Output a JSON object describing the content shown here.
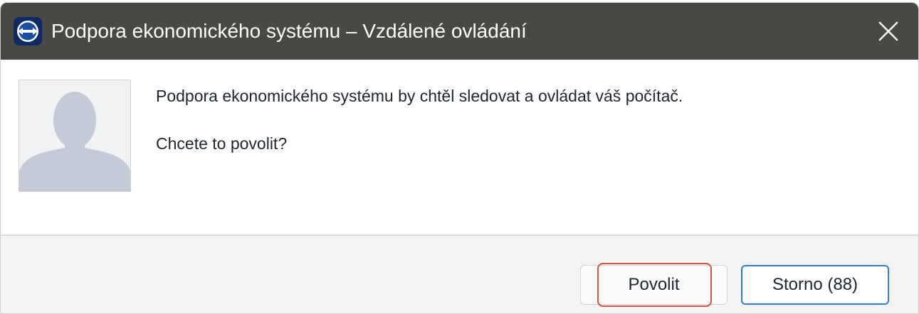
{
  "window": {
    "title": "Podpora ekonomického systému – Vzdálené ovládání",
    "app_icon": "teamviewer-icon",
    "close_icon": "close-icon"
  },
  "message": {
    "line1": "Podpora ekonomického systému by chtěl sledovat a ovládat váš počítač.",
    "line2": "Chcete to povolit?"
  },
  "avatar": {
    "icon": "user-silhouette-icon"
  },
  "buttons": {
    "allow_label": "Povolit",
    "cancel_label": "Storno (88)"
  },
  "colors": {
    "titlebar": "#4a4844",
    "highlight": "#d9533f",
    "focus_border": "#2f7dd3",
    "icon_blue": "#1a4fa0"
  }
}
